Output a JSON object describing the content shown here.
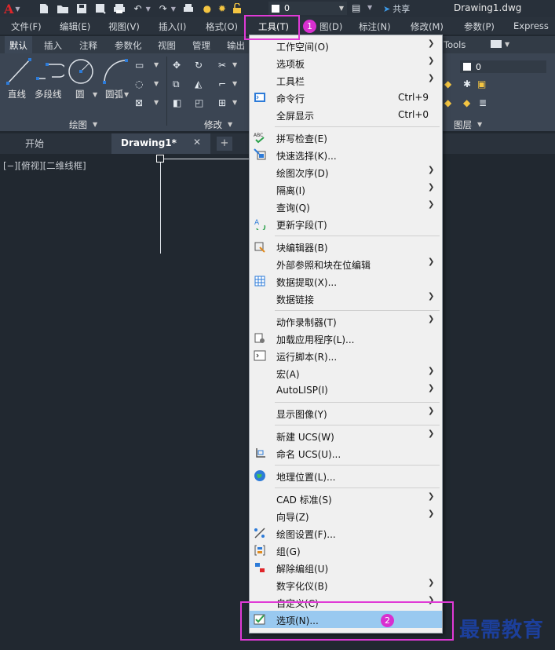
{
  "qat": {
    "logo": "A",
    "layer_value": "0",
    "share_label": "共享",
    "document_title": "Drawing1.dwg"
  },
  "menubar": {
    "items": [
      "文件(F)",
      "编辑(E)",
      "视图(V)",
      "插入(I)",
      "格式(O)",
      "工具(T)",
      "图(D)",
      "标注(N)",
      "修改(M)",
      "参数(P)",
      "Express"
    ]
  },
  "ribbon_tabs": {
    "items": [
      "默认",
      "插入",
      "注释",
      "参数化",
      "视图",
      "管理",
      "输出"
    ],
    "right_label": "Tools"
  },
  "ribbon": {
    "tools": [
      "直线",
      "多段线",
      "圆",
      "圆弧"
    ],
    "draw_panel": "绘图",
    "modify_panel": "修改",
    "layer_panel": "图层",
    "layer_value": "0"
  },
  "file_tabs": {
    "start": "开始",
    "active": "Drawing1*",
    "close_glyph": "✕",
    "new_glyph": "+"
  },
  "canvas": {
    "view_label": "[−][俯视][二维线框]"
  },
  "dropdown": {
    "items": [
      {
        "label": "工作空间(O)",
        "shortcut": "",
        "submenu": true
      },
      {
        "label": "选项板",
        "shortcut": "",
        "submenu": true
      },
      {
        "label": "工具栏",
        "shortcut": "",
        "submenu": true
      },
      {
        "label": "命令行",
        "shortcut": "Ctrl+9",
        "submenu": false
      },
      {
        "label": "全屏显示",
        "shortcut": "Ctrl+0",
        "submenu": false
      },
      {
        "label": "拼写检查(E)",
        "shortcut": "",
        "submenu": false
      },
      {
        "label": "快速选择(K)...",
        "shortcut": "",
        "submenu": false
      },
      {
        "label": "绘图次序(D)",
        "shortcut": "",
        "submenu": true
      },
      {
        "label": "隔离(I)",
        "shortcut": "",
        "submenu": true
      },
      {
        "label": "查询(Q)",
        "shortcut": "",
        "submenu": true
      },
      {
        "label": "更新字段(T)",
        "shortcut": "",
        "submenu": false
      },
      {
        "label": "块编辑器(B)",
        "shortcut": "",
        "submenu": false
      },
      {
        "label": "外部参照和块在位编辑",
        "shortcut": "",
        "submenu": true
      },
      {
        "label": "数据提取(X)...",
        "shortcut": "",
        "submenu": false
      },
      {
        "label": "数据链接",
        "shortcut": "",
        "submenu": true
      },
      {
        "label": "动作录制器(T)",
        "shortcut": "",
        "submenu": true
      },
      {
        "label": "加载应用程序(L)...",
        "shortcut": "",
        "submenu": false
      },
      {
        "label": "运行脚本(R)...",
        "shortcut": "",
        "submenu": false
      },
      {
        "label": "宏(A)",
        "shortcut": "",
        "submenu": true
      },
      {
        "label": "AutoLISP(I)",
        "shortcut": "",
        "submenu": true
      },
      {
        "label": "显示图像(Y)",
        "shortcut": "",
        "submenu": true
      },
      {
        "label": "新建 UCS(W)",
        "shortcut": "",
        "submenu": true
      },
      {
        "label": "命名 UCS(U)...",
        "shortcut": "",
        "submenu": false
      },
      {
        "label": "地理位置(L)...",
        "shortcut": "",
        "submenu": false
      },
      {
        "label": "CAD 标准(S)",
        "shortcut": "",
        "submenu": true
      },
      {
        "label": "向导(Z)",
        "shortcut": "",
        "submenu": true
      },
      {
        "label": "绘图设置(F)...",
        "shortcut": "",
        "submenu": false
      },
      {
        "label": "组(G)",
        "shortcut": "",
        "submenu": false
      },
      {
        "label": "解除编组(U)",
        "shortcut": "",
        "submenu": false
      },
      {
        "label": "数字化仪(B)",
        "shortcut": "",
        "submenu": true
      },
      {
        "label": "自定义(C)",
        "shortcut": "",
        "submenu": true
      },
      {
        "label": "选项(N)...",
        "shortcut": "",
        "submenu": false
      }
    ],
    "highlighted_index": 31
  },
  "annotations": {
    "badge1": "1",
    "badge2": "2",
    "highlight_color": "#e03ad6"
  },
  "watermark": "最需教育"
}
